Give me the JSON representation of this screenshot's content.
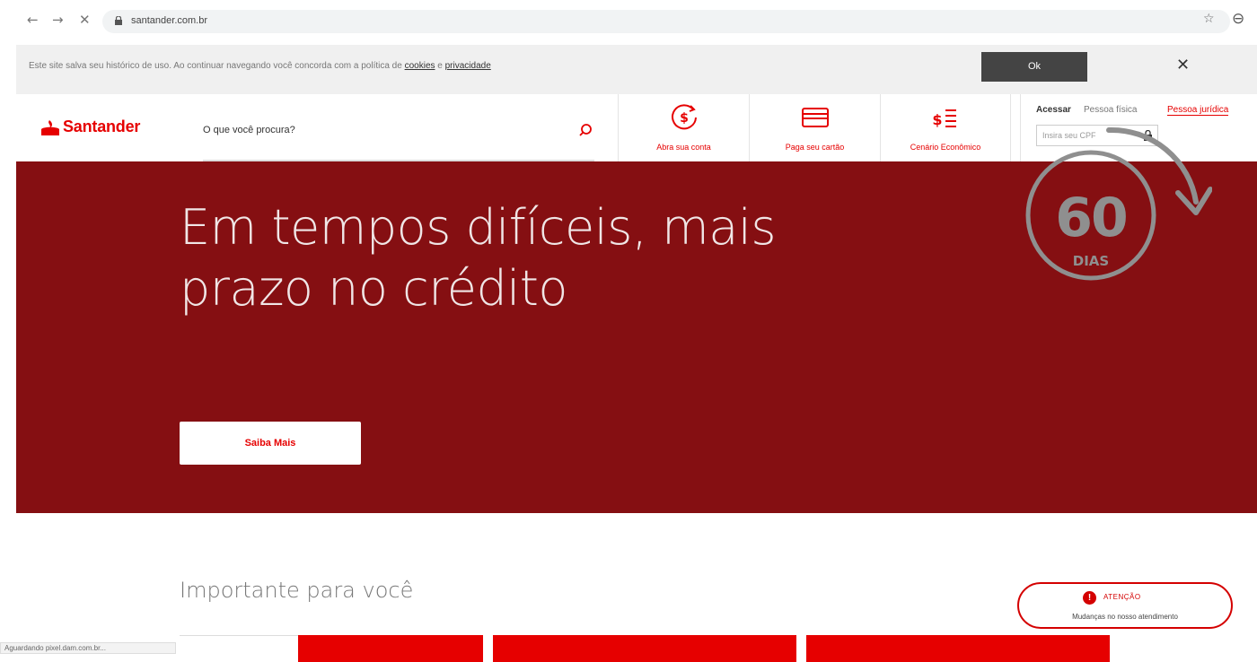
{
  "browser": {
    "url": "santander.com.br",
    "back_icon": "arrow-left-icon",
    "forward_icon": "arrow-right-icon",
    "stop_icon": "close-icon",
    "status_text": "Aguardando pixel.dam.com.br..."
  },
  "cookie": {
    "text_before": "Este site salva seu histórico de uso. Ao continuar navegando você concorda com a política de ",
    "link_cookies": "cookies",
    "text_and": " e ",
    "link_privacy": "privacidade",
    "ok_label": "Ok"
  },
  "header": {
    "logo_text": "Santander",
    "search_placeholder": "O que você procura?",
    "quick_links": [
      {
        "label": "Abra sua conta",
        "icon": "dollar-refresh-icon"
      },
      {
        "label": "Paga seu cartão",
        "icon": "credit-card-icon"
      },
      {
        "label": "Cenário Econômico",
        "icon": "dollar-list-icon"
      }
    ],
    "access": {
      "title": "Acessar",
      "tab_pf": "Pessoa física",
      "tab_pj": "Pessoa jurídica",
      "cpf_placeholder": "Insira seu CPF"
    }
  },
  "hero": {
    "title_line1": "Em tempos difíceis, mais",
    "title_line2": "prazo no crédito",
    "button_label": "Saiba Mais",
    "badge_number": "60",
    "badge_unit": "DIAS",
    "background_color": "#850f12"
  },
  "important": {
    "title": "Importante para você"
  },
  "atencao": {
    "label": "ATENÇÃO",
    "text": "Mudanças no nosso atendimento"
  },
  "colors": {
    "brand": "#e60000",
    "hero_bg": "#850f12"
  }
}
